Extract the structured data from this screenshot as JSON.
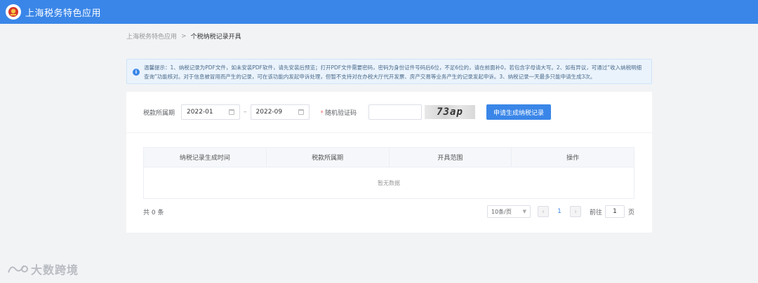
{
  "header": {
    "app_title": "上海税务特色应用",
    "logo_icon": "tax-emblem-icon",
    "bg_color": "#3a86e8"
  },
  "breadcrumb": {
    "root": "上海税务特色应用",
    "separator": ">",
    "current": "个税纳税记录开具"
  },
  "notice": {
    "text": "温馨提示：1、纳税记录为PDF文件，如未安装PDF软件，请先安装后预览；打开PDF文件需要密码，密码为身份证件号码后6位，不足6位的，请在前面补0，若包含字母请大写。2、如有异议，可通过“收入纳税明细查询”功能核对。对于信息被冒用而产生的记录，可在该功能内发起申诉处理，但暂不支持对在办税大厅代开发票、房产交易等业务产生的记录发起申诉。3、纳税记录一天最多只能申请生成3次。"
  },
  "form": {
    "period_label": "税款所属期",
    "start_period": "2022-01",
    "end_period": "2022-09",
    "range_sep": "–",
    "captcha_required_mark": "*",
    "captcha_label": "随机验证码",
    "captcha_value": "",
    "captcha_image_text": "73ap",
    "submit_label": "申请生成纳税记录"
  },
  "table": {
    "columns": [
      "纳税记录生成时间",
      "税款所属期",
      "开具范围",
      "操作"
    ],
    "empty_text": "暂无数据"
  },
  "pagination": {
    "total_text": "共 0 条",
    "page_size": "10条/页",
    "current_page": "1",
    "goto_label": "前往",
    "goto_value": "1",
    "page_suffix": "页"
  },
  "watermark": {
    "text": "大数跨境"
  }
}
